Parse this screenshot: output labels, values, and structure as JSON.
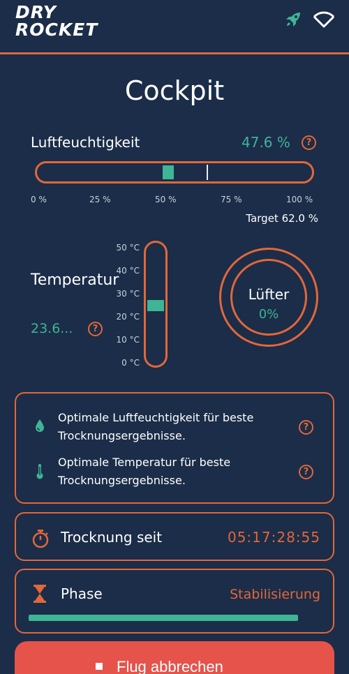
{
  "header": {
    "logo_line1": "DRY",
    "logo_line2": "ROCKET",
    "rocket_icon": "rocket-icon",
    "wifi_icon": "wifi-icon"
  },
  "page": {
    "title": "Cockpit"
  },
  "humidity": {
    "label": "Luftfeuchtigkeit",
    "value_text": "47.6 %",
    "value": 47.6,
    "target": 62.0,
    "target_text": "Target 62.0 %",
    "ticks": [
      "0 %",
      "25 %",
      "50 %",
      "75 %",
      "100 %"
    ]
  },
  "temperature": {
    "label": "Temperatur",
    "value_text": "23.6...",
    "value": 23.6,
    "min": 0,
    "max": 50,
    "scale": [
      "50 °C",
      "40 °C",
      "30 °C",
      "20 °C",
      "10 °C",
      "0 °C"
    ]
  },
  "fan": {
    "label": "Lüfter",
    "value": "0%"
  },
  "info": [
    {
      "icon": "water-drop-icon",
      "text": "Optimale Luftfeuchtigkeit für beste Trocknungsergebnisse."
    },
    {
      "icon": "thermometer-icon",
      "text": "Optimale Temperatur für beste Trocknungsergebnisse."
    }
  ],
  "drying": {
    "label": "Trocknung seit",
    "time": "05:17:28:55"
  },
  "phase": {
    "label": "Phase",
    "value": "Stabilisierung",
    "progress": 0.99
  },
  "abort": {
    "label": "Flug abbrechen"
  },
  "colors": {
    "background": "#1b2d48",
    "accent": "#e2673a",
    "teal": "#3fb497",
    "danger": "#e5534b"
  }
}
